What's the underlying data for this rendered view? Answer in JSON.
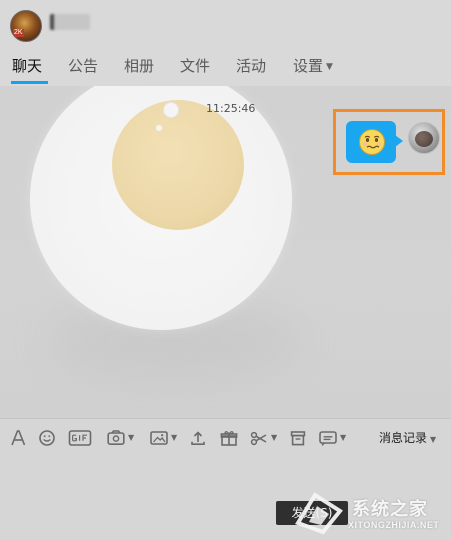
{
  "header": {
    "avatar_badge": "2K"
  },
  "tabs": [
    {
      "label": "聊天",
      "active": true
    },
    {
      "label": "公告"
    },
    {
      "label": "相册"
    },
    {
      "label": "文件"
    },
    {
      "label": "活动"
    },
    {
      "label": "设置",
      "has_dropdown": true
    }
  ],
  "chat": {
    "timestamp": "11:25:46",
    "message": {
      "type": "emoji",
      "emoji_icon": "worried-face-icon"
    }
  },
  "toolbar": {
    "items": [
      "font-icon",
      "emoji-icon",
      "gif-icon",
      "screenshot-icon",
      "image-icon",
      "upload-icon",
      "gift-icon",
      "scissors-icon",
      "archive-icon",
      "more-icon"
    ],
    "history_label": "消息记录"
  },
  "input": {
    "send_label": "发送(S)"
  },
  "watermark": {
    "text": "系统之家",
    "url": "XITONGZHIJIA.NET"
  },
  "colors": {
    "accent": "#12a3f0",
    "highlight_border": "#f28c28",
    "bubble": "#1aa7f0"
  }
}
